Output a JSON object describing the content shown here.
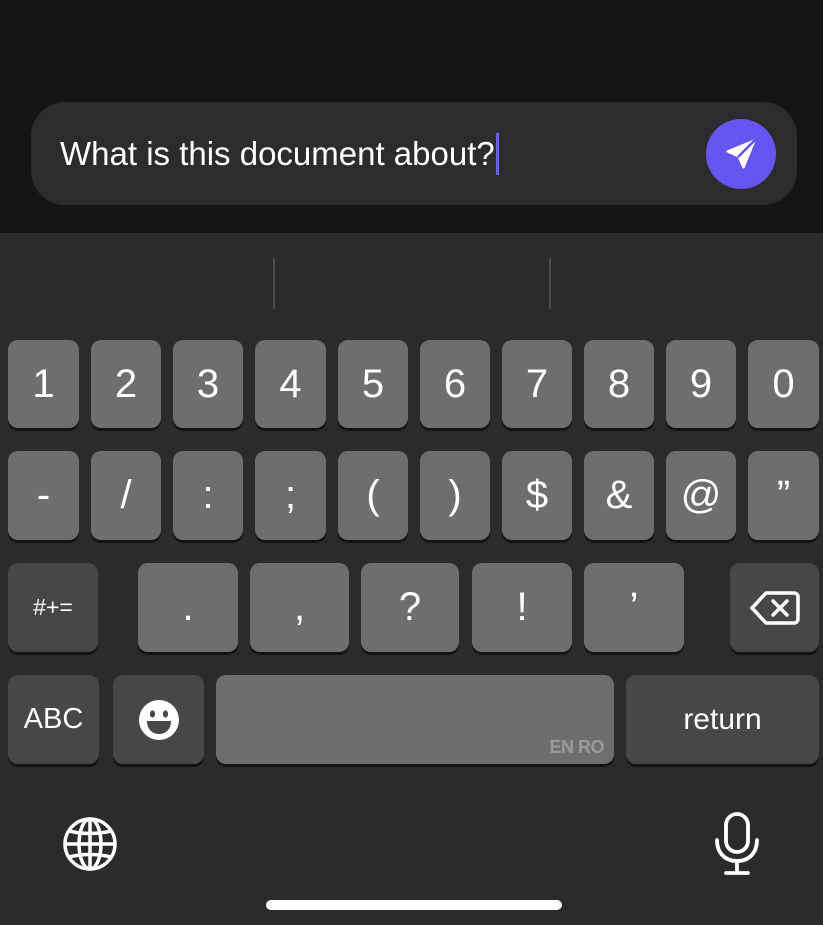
{
  "composer": {
    "text": "What is this document about?"
  },
  "keyboard": {
    "row1": [
      "1",
      "2",
      "3",
      "4",
      "5",
      "6",
      "7",
      "8",
      "9",
      "0"
    ],
    "row2": [
      "-",
      "/",
      ":",
      ";",
      "(",
      ")",
      "$",
      "&",
      "@",
      "”"
    ],
    "row3": {
      "mode_key": "#+=",
      "keys": [
        ".",
        ",",
        "?",
        "!",
        "’"
      ]
    },
    "row4": {
      "abc_key": "ABC",
      "space_hint": "EN RO",
      "return_key": "return"
    }
  },
  "icons": {
    "send": "send-icon",
    "backspace": "backspace-icon",
    "emoji": "emoji-icon",
    "globe": "globe-icon",
    "mic": "microphone-icon"
  },
  "colors": {
    "accent": "#6656f1",
    "background_top": "#151517",
    "keyboard_bg": "#2b2b2d",
    "key_light": "#6e6e70",
    "key_dark": "#474749"
  }
}
